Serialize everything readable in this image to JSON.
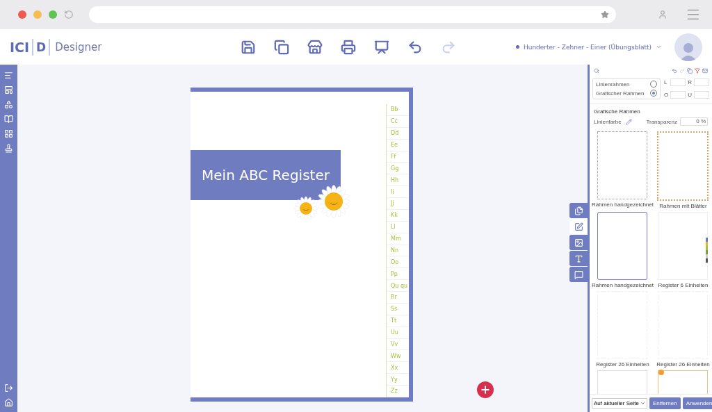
{
  "app": {
    "logo_left": "ICI",
    "logo_mark": "D",
    "logo_name": "Designer"
  },
  "toolbar": [
    {
      "kind": "save",
      "disabled": false
    },
    {
      "kind": "save-as",
      "disabled": false
    },
    {
      "kind": "publish",
      "disabled": false
    },
    {
      "kind": "print",
      "disabled": false
    },
    {
      "kind": "present",
      "disabled": false
    },
    {
      "kind": "undo",
      "disabled": false
    },
    {
      "kind": "redo",
      "disabled": true
    }
  ],
  "document": {
    "title": "Hunderter - Zehner - Einer (Übungsblatt)"
  },
  "sidebar": {
    "top": [
      {
        "kind": "menu"
      },
      {
        "kind": "layout"
      },
      {
        "kind": "shapes"
      },
      {
        "kind": "book"
      },
      {
        "kind": "grid"
      },
      {
        "kind": "stamp"
      }
    ],
    "bottom": [
      {
        "kind": "exit"
      },
      {
        "kind": "home"
      }
    ]
  },
  "page": {
    "title": "Mein ABC Register",
    "tabs": [
      "Bb",
      "Cc",
      "Dd",
      "Ee",
      "Ff",
      "Gg",
      "Hh",
      "Ii",
      "Jj",
      "Kk",
      "Ll",
      "Mm",
      "Nn",
      "Oo",
      "Pp",
      "Qu qu",
      "Rr",
      "Ss",
      "Tt",
      "Uu",
      "Vv",
      "Ww",
      "Xx",
      "Yy",
      "Zz"
    ]
  },
  "side_tabs": [
    {
      "kind": "pages",
      "selected": false
    },
    {
      "kind": "frame",
      "selected": true
    },
    {
      "kind": "image",
      "selected": false
    },
    {
      "kind": "text",
      "selected": false
    },
    {
      "kind": "comments",
      "selected": false
    }
  ],
  "panel": {
    "frame_types": [
      {
        "label": "Linienrahmen",
        "selected": false
      },
      {
        "label": "Grafischer Rahmen",
        "selected": true
      }
    ],
    "margins": [
      "L",
      "R",
      "O",
      "U"
    ],
    "section": "Grafische Rahmen",
    "line_color_label": "Linienfarbe",
    "transparency_label": "Transparenz",
    "transparency": "0 %",
    "frames": [
      {
        "label": "Rahmen handgezeichnet",
        "kind": "dotted"
      },
      {
        "label": "Rahmen mit Blätter",
        "kind": "leaves"
      },
      {
        "label": "Rahmen handgezeichnet",
        "kind": "hand"
      },
      {
        "label": "Register 6 Einheiten",
        "kind": "register6"
      },
      {
        "label": "Register 26 Einheiten",
        "kind": "faint"
      },
      {
        "label": "Register 26 Einheiten",
        "kind": "faint"
      },
      {
        "kind": "plain"
      },
      {
        "kind": "bee"
      }
    ],
    "scope": "Auf aktueller Seite",
    "buttons": [
      "Entfernen",
      "Anwenden"
    ]
  }
}
